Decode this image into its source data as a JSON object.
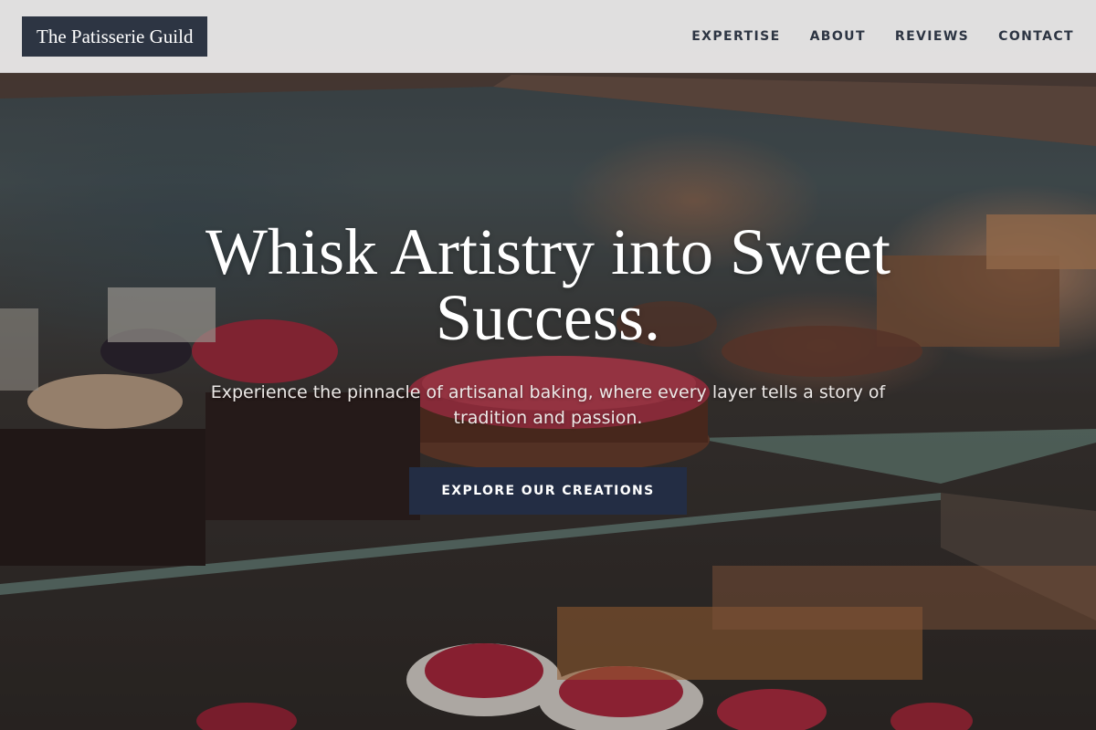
{
  "brand": {
    "logo_text": "The Patisserie Guild"
  },
  "nav": {
    "items": [
      {
        "label": "EXPERTISE"
      },
      {
        "label": "ABOUT"
      },
      {
        "label": "REVIEWS"
      },
      {
        "label": "CONTACT"
      }
    ]
  },
  "hero": {
    "title": "Whisk Artistry into Sweet Success.",
    "subtitle": "Experience the pinnacle of artisanal baking, where every layer tells a story of tradition and passion.",
    "cta_label": "EXPLORE OUR CREATIONS",
    "background_image_icon": "pastry-display-case-photo"
  },
  "colors": {
    "header_bg": "#eeecec",
    "logo_bg": "#2d3543",
    "nav_text": "#2d3543",
    "cta_bg": "#232d44",
    "hero_text": "#ffffff"
  }
}
